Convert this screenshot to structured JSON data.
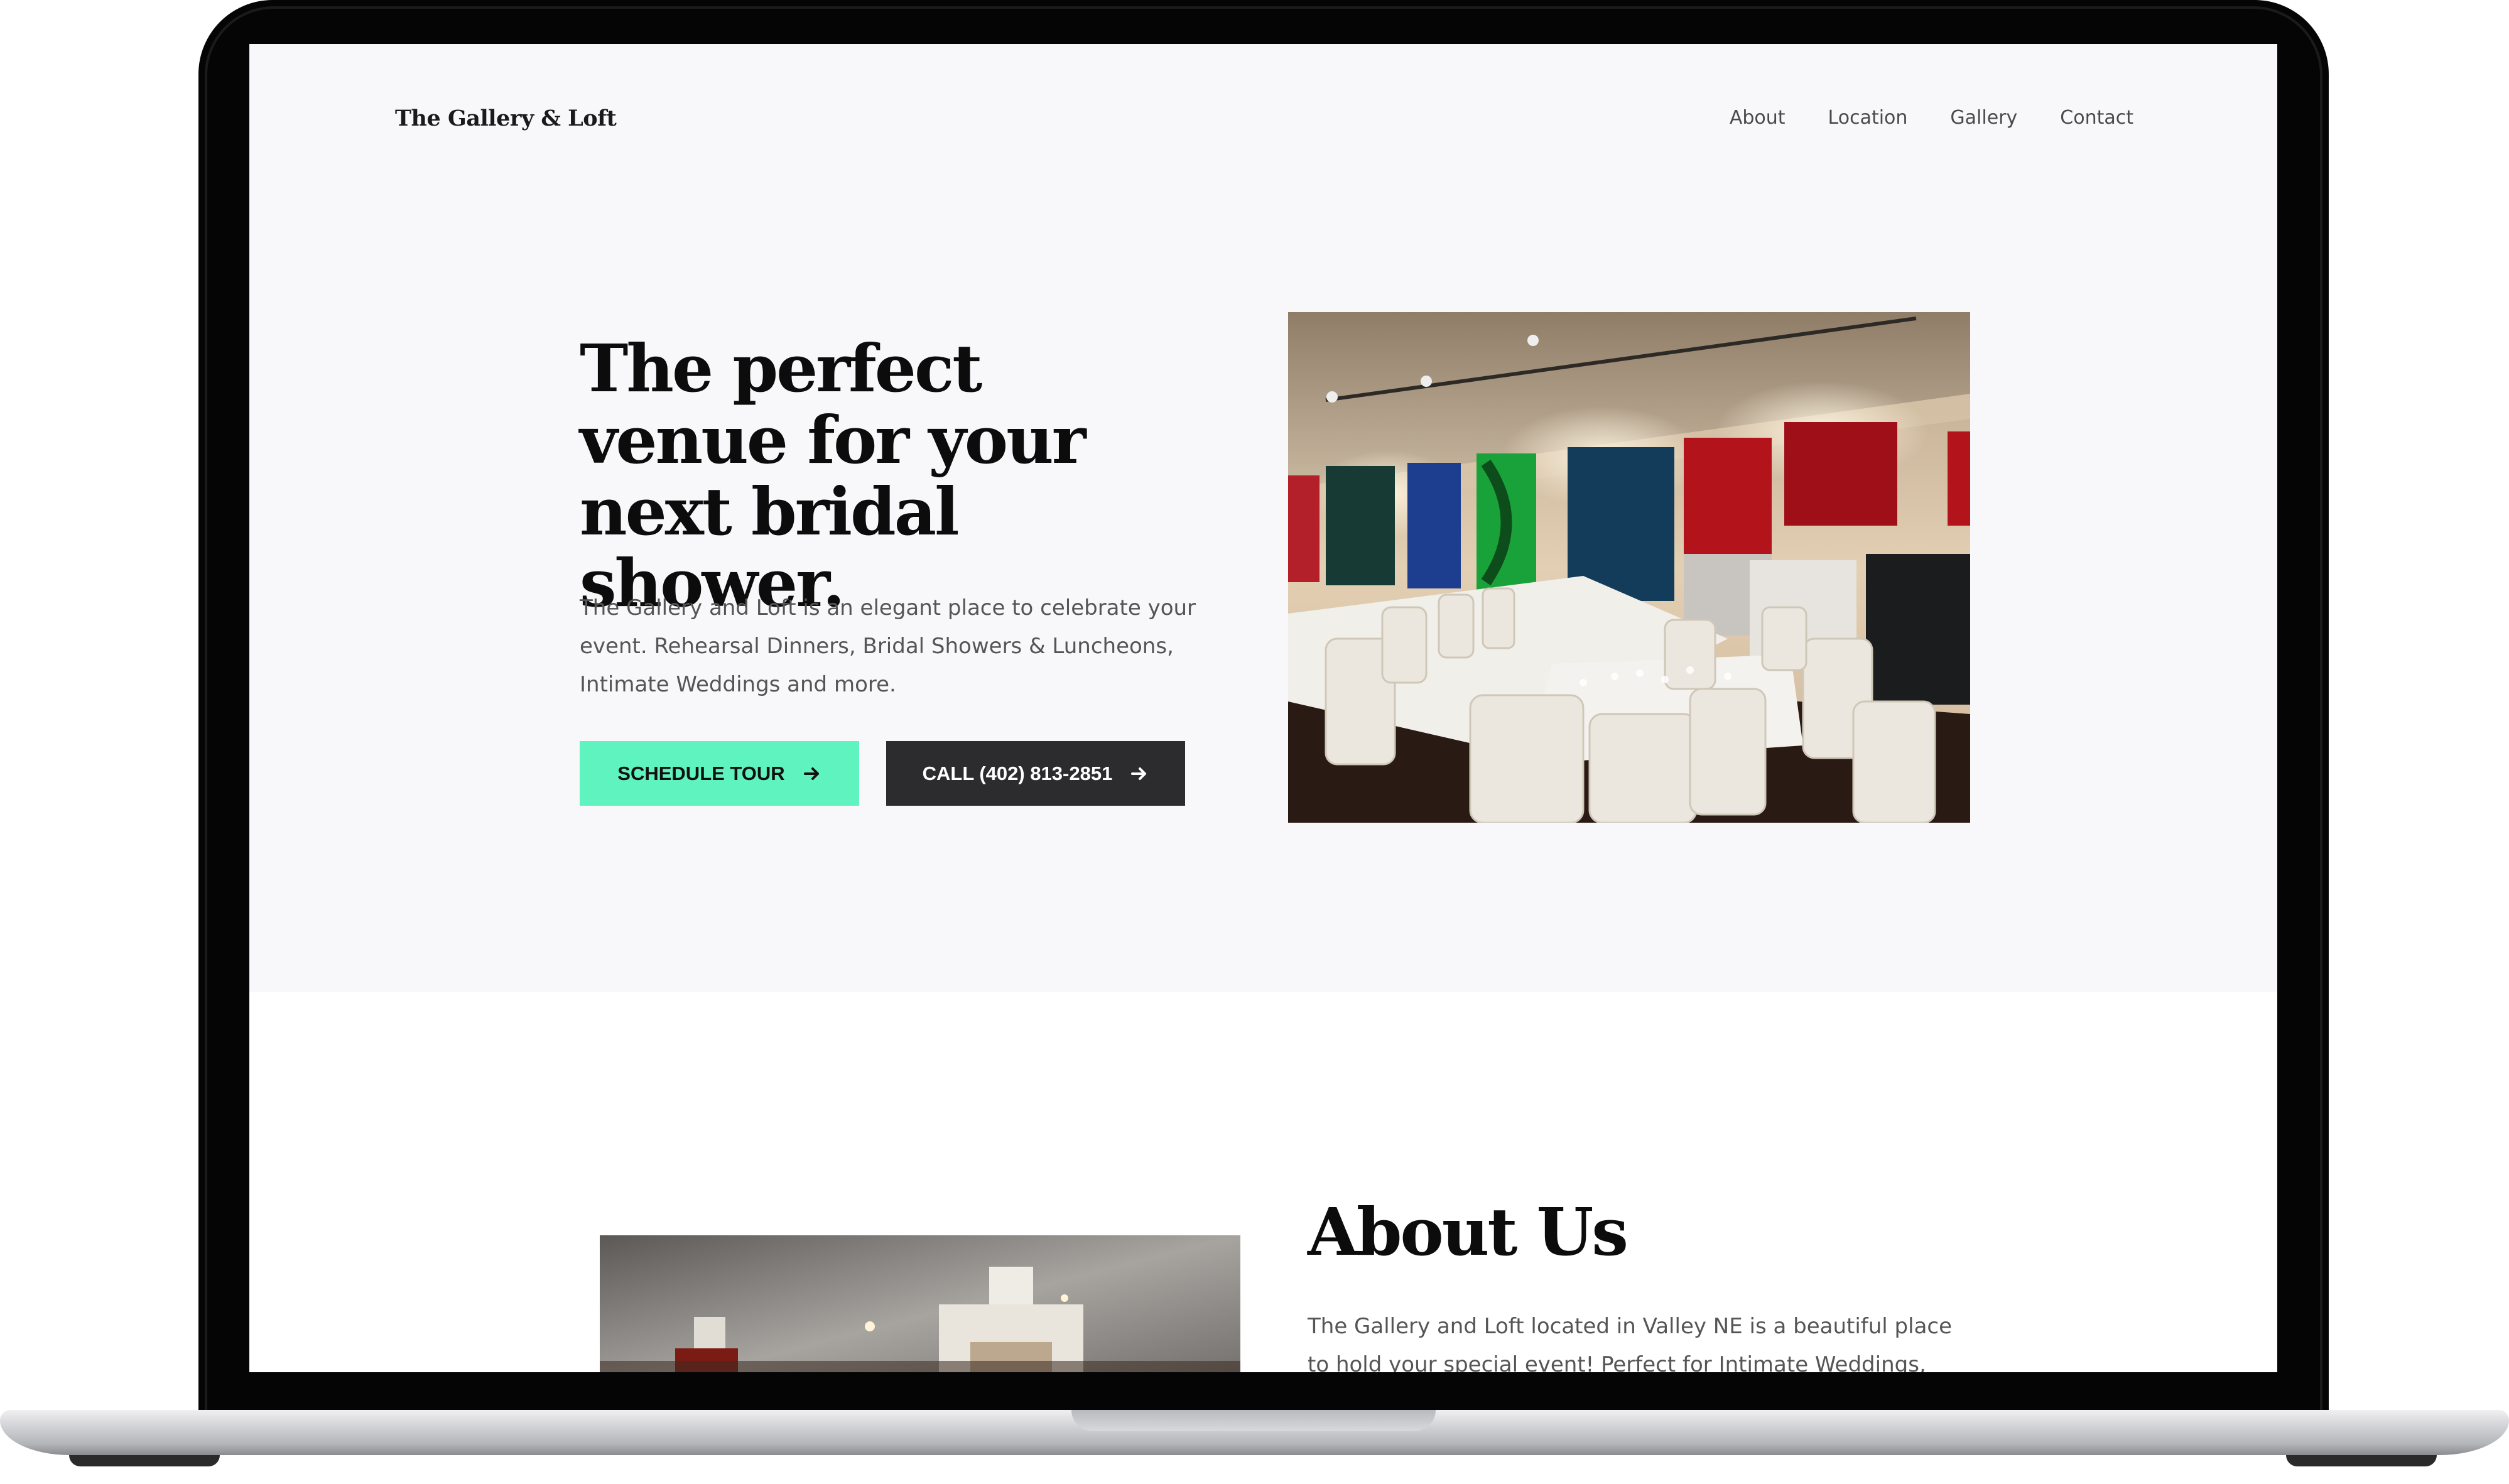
{
  "site": {
    "brand": "The Gallery & Loft",
    "nav": [
      {
        "label": "About"
      },
      {
        "label": "Location"
      },
      {
        "label": "Gallery"
      },
      {
        "label": "Contact"
      }
    ]
  },
  "hero": {
    "title": "The perfect venue for your next bridal shower.",
    "description": "The Gallery and Loft is an elegant place to celebrate your event. Rehearsal Dinners, Bridal Showers & Luncheons, Intimate Weddings and more.",
    "buttons": {
      "tour_label": "Schedule Tour",
      "call_label": "CALL (402) 813-2851"
    }
  },
  "about": {
    "title": "About Us",
    "description": "The Gallery and Loft located in Valley NE is a beautiful place to hold your special event! Perfect for Intimate Weddings,"
  },
  "colors": {
    "accent": "#5ff3bf",
    "dark_button": "#2c2c2e",
    "hero_background": "#f8f8fa"
  }
}
